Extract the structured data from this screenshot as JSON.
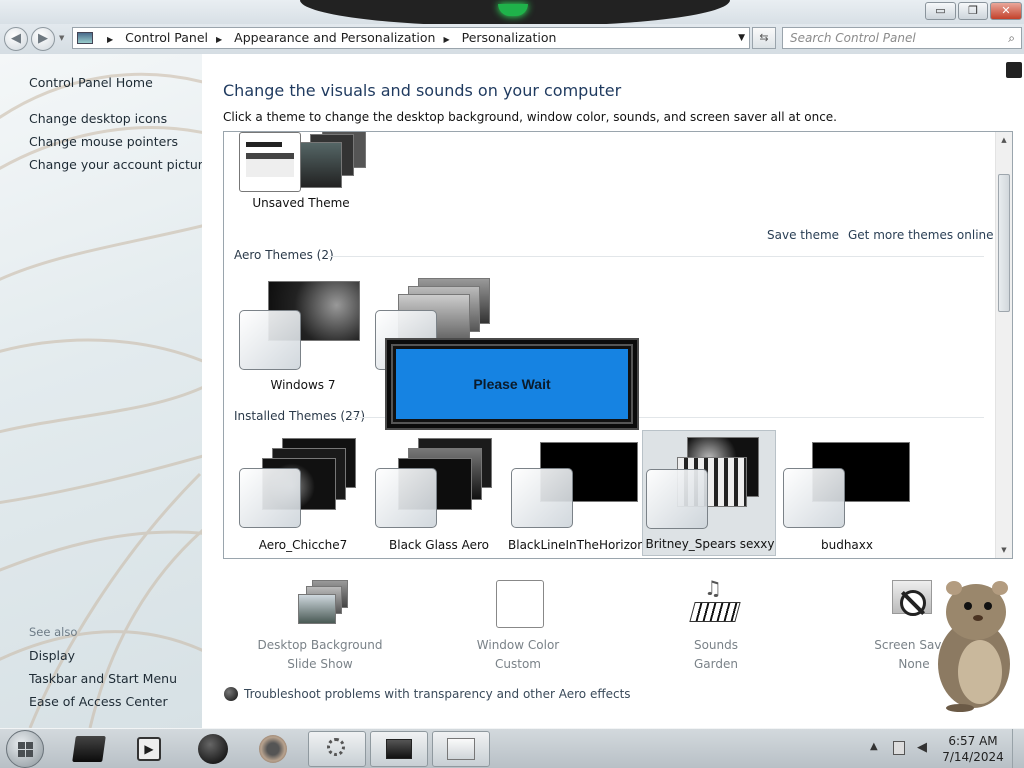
{
  "window": {
    "controls": {
      "minimize": "▭",
      "maximize": "❐",
      "close": "✕"
    }
  },
  "navigation": {
    "back_icon": "back-arrow-icon",
    "forward_icon": "forward-arrow-icon",
    "breadcrumb": [
      "Control Panel",
      "Appearance and Personalization",
      "Personalization"
    ],
    "search_placeholder": "Search Control Panel"
  },
  "sidebar": {
    "home": "Control Panel Home",
    "tasks": [
      "Change desktop icons",
      "Change mouse pointers",
      "Change your account picture"
    ],
    "see_also_title": "See also",
    "see_also": [
      "Display",
      "Taskbar and Start Menu",
      "Ease of Access Center"
    ]
  },
  "main": {
    "title": "Change the visuals and sounds on your computer",
    "subtitle": "Click a theme to change the desktop background, window color, sounds, and screen saver all at once.",
    "my_theme": {
      "name": "Unsaved Theme"
    },
    "links": {
      "save_theme": "Save theme",
      "get_more": "Get more themes online"
    },
    "aero_group": {
      "label": "Aero Themes (2)",
      "themes": [
        {
          "name": "Windows 7"
        },
        {
          "name": ""
        }
      ]
    },
    "installed_group": {
      "label": "Installed Themes (27)",
      "themes": [
        {
          "name": "Aero_Chicche7",
          "selected": false
        },
        {
          "name": "Black Glass Aero",
          "selected": false
        },
        {
          "name": "BlackLineInTheHorizon",
          "selected": false
        },
        {
          "name": "Britney_Spears sexxy",
          "selected": true
        },
        {
          "name": "budhaxx",
          "selected": false
        }
      ]
    },
    "overlay": {
      "text": "Please Wait",
      "color": "#1683e2"
    },
    "options": [
      {
        "label": "Desktop Background",
        "value": "Slide Show"
      },
      {
        "label": "Window Color",
        "value": "Custom"
      },
      {
        "label": "Sounds",
        "value": "Garden"
      },
      {
        "label": "Screen Saver",
        "value": "None"
      }
    ],
    "troubleshoot": "Troubleshoot problems with transparency and other Aero effects"
  },
  "taskbar": {
    "clock": {
      "time": "6:57 AM",
      "date": "7/14/2024"
    }
  }
}
